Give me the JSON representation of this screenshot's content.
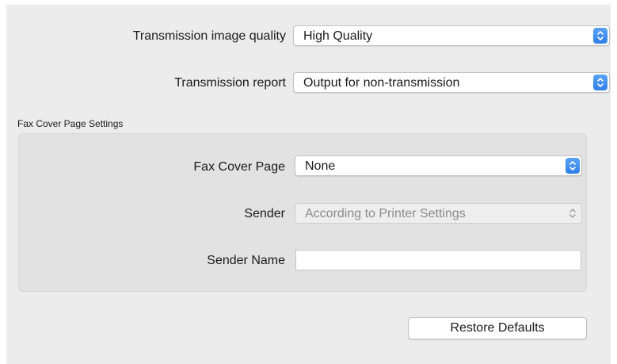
{
  "quality": {
    "label": "Transmission image quality",
    "value": "High Quality"
  },
  "report": {
    "label": "Transmission report",
    "value": "Output for non-transmission"
  },
  "cover_section": {
    "title": "Fax Cover Page Settings",
    "cover_page": {
      "label": "Fax Cover Page",
      "value": "None"
    },
    "sender": {
      "label": "Sender",
      "value": "According to Printer Settings",
      "disabled": true
    },
    "sender_name": {
      "label": "Sender Name",
      "value": ""
    }
  },
  "restore_button": {
    "label": "Restore Defaults"
  },
  "colors": {
    "accent": "#3b8beb",
    "panel_bg": "#ececec",
    "group_bg": "#e2e2e2",
    "disabled_text": "#8a8a8a"
  },
  "icons": {
    "popup_stepper": "up-down-chevron-icon"
  }
}
